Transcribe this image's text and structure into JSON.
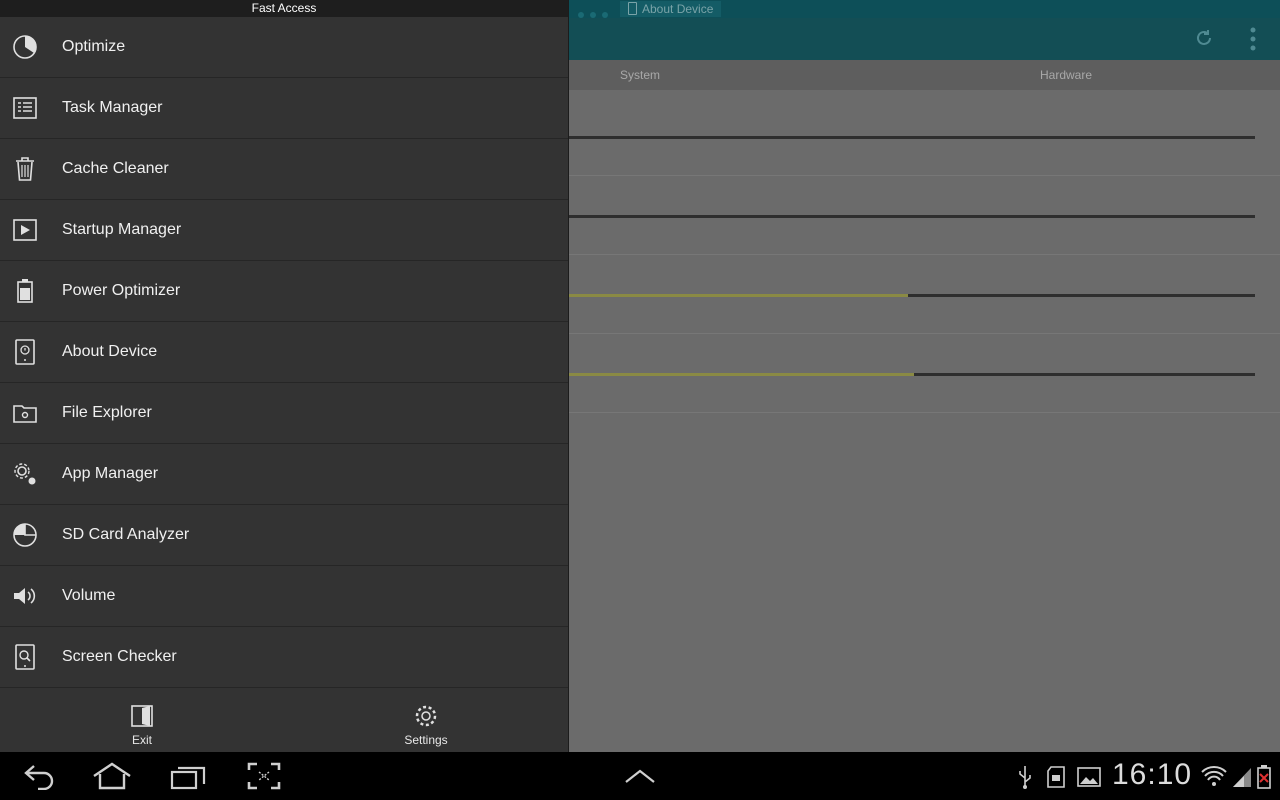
{
  "background": {
    "notification": "About Device",
    "tabs": [
      "System",
      "Hardware"
    ],
    "bars": [
      {
        "fill": 0.0
      },
      {
        "fill": 0.0
      },
      {
        "fill": 0.5
      },
      {
        "fill": 0.51
      }
    ],
    "colors": {
      "statusbar": "#0d4f58",
      "actionbar": "#134e55",
      "bar_fill": "#8a8a44",
      "bar_track": "#2e2e2e"
    }
  },
  "drawer": {
    "title": "Fast Access",
    "items": [
      {
        "label": "Optimize",
        "icon": "pie-clock-icon"
      },
      {
        "label": "Task Manager",
        "icon": "task-list-icon"
      },
      {
        "label": "Cache Cleaner",
        "icon": "trash-icon"
      },
      {
        "label": "Startup Manager",
        "icon": "play-box-icon"
      },
      {
        "label": "Power Optimizer",
        "icon": "battery-icon"
      },
      {
        "label": "About Device",
        "icon": "device-info-icon"
      },
      {
        "label": "File Explorer",
        "icon": "folder-gear-icon"
      },
      {
        "label": "App Manager",
        "icon": "gears-icon"
      },
      {
        "label": "SD Card Analyzer",
        "icon": "pie-chart-icon"
      },
      {
        "label": "Volume",
        "icon": "speaker-icon"
      },
      {
        "label": "Screen Checker",
        "icon": "screen-search-icon"
      }
    ],
    "footer": {
      "exit_label": "Exit",
      "settings_label": "Settings"
    }
  },
  "navbar": {
    "clock": "16:10",
    "icons": [
      "back-icon",
      "home-icon",
      "recent-apps-icon",
      "screenshot-icon",
      "up-arrow-icon",
      "usb-icon",
      "sd-card-icon",
      "gallery-icon",
      "wifi-icon",
      "signal-icon",
      "battery-alert-icon"
    ]
  }
}
